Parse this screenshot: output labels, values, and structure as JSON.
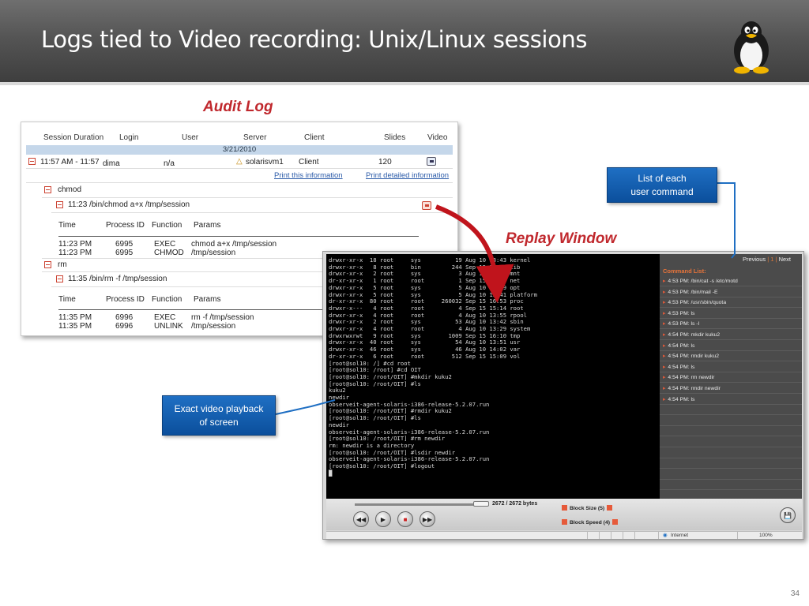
{
  "slide": {
    "title": "Logs tied to Video recording: Unix/Linux sessions",
    "page_number": "34",
    "audit_log_label": "Audit Log",
    "replay_window_label": "Replay Window"
  },
  "callouts": {
    "list_commands": [
      "List of each",
      "user command"
    ],
    "exact_playback": [
      "Exact video playback",
      "of screen"
    ]
  },
  "audit": {
    "columns": [
      "Session Duration",
      "Login",
      "User",
      "Server",
      "Client",
      "Slides",
      "Video"
    ],
    "date": "3/21/2010",
    "session": {
      "duration": "11:57 AM - 11:57 /",
      "login": "dima",
      "user": "n/a",
      "server": "solarisvm1",
      "client": "Client",
      "slides": "120"
    },
    "links": [
      "Print this information",
      "Print detailed information"
    ],
    "groups": [
      {
        "name": "chmod",
        "entry": "11:23  /bin/chmod a+x /tmp/session",
        "headers": [
          "Time",
          "Process ID",
          "Function",
          "Params"
        ],
        "rows": [
          [
            "11:23 PM",
            "6995",
            "EXEC",
            "chmod a+x /tmp/session"
          ],
          [
            "11:23 PM",
            "6995",
            "CHMOD",
            "/tmp/session"
          ]
        ]
      },
      {
        "name": "rm",
        "entry": "11:35  /bin/rm -f /tmp/session",
        "headers": [
          "Time",
          "Process ID",
          "Function",
          "Params"
        ],
        "rows": [
          [
            "11:35 PM",
            "6996",
            "EXEC",
            "rm -f /tmp/session"
          ],
          [
            "11:35 PM",
            "6996",
            "UNLINK",
            "/tmp/session"
          ]
        ]
      }
    ]
  },
  "replay": {
    "terminal_lines": [
      "drwxr-xr-x  18 root     sys          19 Aug 10 13:43 kernel",
      "drwxr-xr-x   8 root     bin         244 Sep 15 15:16 lib",
      "drwxr-xr-x   2 root     sys           3 Aug 10 14:07 mnt",
      "dr-xr-xr-x   1 root     root          1 Sep 15 15:09 net",
      "drwxr-xr-x   5 root     sys           5 Aug 10 13:49 opt",
      "drwxr-xr-x   5 root     sys           5 Aug 10 13:41 platform",
      "dr-xr-xr-x  80 root     root     260032 Sep 15 16:53 proc",
      "drwxr-x---   4 root     root          4 Sep 15 15:14 root",
      "drwxr-xr-x   4 root     root          4 Aug 10 13:55 rpool",
      "drwxr-xr-x   2 root     sys          53 Aug 10 13:42 sbin",
      "drwxr-xr-x   4 root     root          4 Aug 10 13:29 system",
      "drwxrwxrwt   9 root     sys        1009 Sep 15 16:10 tmp",
      "drwxr-xr-x  40 root     sys          54 Aug 10 13:51 usr",
      "drwxr-xr-x  46 root     sys          46 Aug 10 14:02 var",
      "dr-xr-xr-x   6 root     root        512 Sep 15 15:09 vol",
      "[root@sol10: /] #cd root",
      "[root@sol10: /root] #cd OIT",
      "[root@sol10: /root/OIT] #mkdir kuku2",
      "[root@sol10: /root/OIT] #ls",
      "kuku2",
      "newdir",
      "observeit-agent-solaris-i386-release-5.2.07.run",
      "[root@sol10: /root/OIT] #rmdir kuku2",
      "[root@sol10: /root/OIT] #ls",
      "newdir",
      "observeit-agent-solaris-i386-release-5.2.07.run",
      "[root@sol10: /root/OIT] #rm newdir",
      "rm: newdir is a directory",
      "[root@sol10: /root/OIT] #lsdir newdir",
      "observeit-agent-solaris-i386-release-5.2.07.run",
      "[root@sol10: /root/OIT] #logout",
      "█"
    ],
    "nav": {
      "prev": "Previous",
      "current": "1",
      "next": "Next"
    },
    "command_list_title": "Command List:",
    "commands": [
      "4:53 PM: /bin/cat -s /etc/motd",
      "4:53 PM: /bin/mail -E",
      "4:53 PM: /usr/sbin/quota",
      "4:53 PM: ls",
      "4:53 PM: ls -l",
      "4:54 PM: mkdir kuku2",
      "4:54 PM: ls",
      "4:54 PM: rmdir kuku2",
      "4:54 PM: ls",
      "4:54 PM: rm newdir",
      "4:54 PM: rmdir newdir",
      "4:54 PM: ls"
    ],
    "bytes": "2672  /  2672 bytes",
    "seek_fraction": 1.0,
    "block_size": "Block Size (5)",
    "block_speed": "Block Speed (4)",
    "status_zone": "Internet",
    "status_zoom": "100%"
  },
  "colors": {
    "label_red": "#c0282d",
    "callout_blue": "#0b4f9c",
    "arrow_red": "#c0141c",
    "connector_blue": "#1f6fc3"
  }
}
